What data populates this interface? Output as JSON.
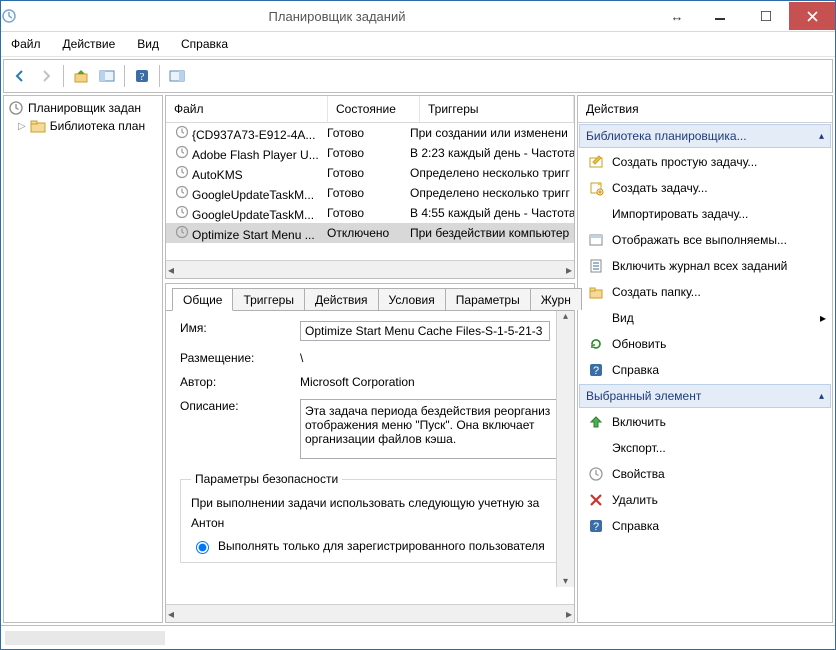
{
  "window": {
    "title": "Планировщик заданий"
  },
  "menu": {
    "file": "Файл",
    "action": "Действие",
    "view": "Вид",
    "help": "Справка"
  },
  "colors": {
    "accent": "#2e6da4",
    "section_bg": "#e4ecf7",
    "section_border": "#bcd0e9",
    "section_fg": "#1f3b7b"
  },
  "tree": {
    "root": "Планировщик задан",
    "child": "Библиотека план"
  },
  "list": {
    "headers": {
      "file": "Файл",
      "state": "Состояние",
      "triggers": "Триггеры"
    },
    "rows": [
      {
        "file": "{CD937A73-E912-4A...",
        "state": "Готово",
        "trig": "При создании или изменени"
      },
      {
        "file": "Adobe Flash Player U...",
        "state": "Готово",
        "trig": "В 2:23 каждый день - Частота"
      },
      {
        "file": "AutoKMS",
        "state": "Готово",
        "trig": "Определено несколько тригг"
      },
      {
        "file": "GoogleUpdateTaskM...",
        "state": "Готово",
        "trig": "Определено несколько тригг"
      },
      {
        "file": "GoogleUpdateTaskM...",
        "state": "Готово",
        "trig": "В 4:55 каждый день - Частота"
      },
      {
        "file": "Optimize Start Menu ...",
        "state": "Отключено",
        "trig": "При бездействии компьютер"
      }
    ]
  },
  "tabs": {
    "general": "Общие",
    "triggers": "Триггеры",
    "actions": "Действия",
    "conditions": "Условия",
    "params": "Параметры",
    "journal": "Журн"
  },
  "form": {
    "name_label": "Имя:",
    "name_value": "Optimize Start Menu Cache Files-S-1-5-21-3",
    "location_label": "Размещение:",
    "location_value": "\\",
    "author_label": "Автор:",
    "author_value": "Microsoft Corporation",
    "desc_label": "Описание:",
    "desc_value": "Эта задача периода бездействия реорганиз отображения меню \"Пуск\". Она включает организации файлов кэша.",
    "security_legend": "Параметры безопасности",
    "security_text": "При выполнении задачи использовать следующую учетную за",
    "security_user": "Антон",
    "security_radio": "Выполнять только для зарегистрированного пользователя"
  },
  "actions_panel": {
    "header": "Действия",
    "section_library": "Библиотека планировщика...",
    "library_items": [
      {
        "icon": "wizard",
        "label": "Создать простую задачу..."
      },
      {
        "icon": "new",
        "label": "Создать задачу..."
      },
      {
        "icon": "none",
        "label": "Импортировать задачу..."
      },
      {
        "icon": "show",
        "label": "Отображать все выполняемы..."
      },
      {
        "icon": "log",
        "label": "Включить журнал всех заданий"
      },
      {
        "icon": "folder",
        "label": "Создать папку..."
      },
      {
        "icon": "none",
        "label": "Вид",
        "caret": true
      },
      {
        "icon": "refresh",
        "label": "Обновить"
      },
      {
        "icon": "help",
        "label": "Справка"
      }
    ],
    "section_selected": "Выбранный элемент",
    "selected_items": [
      {
        "icon": "enable",
        "label": "Включить"
      },
      {
        "icon": "none",
        "label": "Экспорт..."
      },
      {
        "icon": "props",
        "label": "Свойства"
      },
      {
        "icon": "delete",
        "label": "Удалить"
      },
      {
        "icon": "help",
        "label": "Справка"
      }
    ]
  }
}
